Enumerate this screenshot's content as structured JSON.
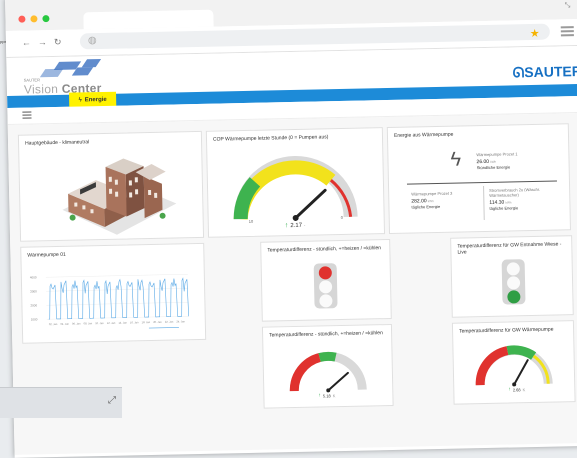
{
  "background": {
    "label": "ppen"
  },
  "app": {
    "logo_small": "SAUTER",
    "logo_title_a": "Vision ",
    "logo_title_b": "Center",
    "brand": "SAUTER",
    "tab_energy": "Energie",
    "tab_energy_icon": "lightning-icon"
  },
  "colors": {
    "accent_blue": "#1d8bd8",
    "tab_yellow": "#fff200",
    "gauge_green": "#3eb34f",
    "gauge_yellow": "#f2e21c",
    "gauge_red": "#e0322e",
    "gauge_grey": "#d9d9d9"
  },
  "cards": {
    "building": {
      "title": "Hauptgebäude - klimaneutral"
    },
    "cop": {
      "title": "COP Wärmepumpe letzte Stunde (0 = Pumpen aus)",
      "value": "2.17",
      "unit": "-",
      "min": "10",
      "max": "0"
    },
    "energy": {
      "title": "Energie aus Wärmepumpe",
      "hour": {
        "label": "Wärmepumpe Prozet 1",
        "value": "26.00",
        "unit": "kWh",
        "caption": "Stündliche Energie"
      },
      "daily_a": {
        "label": "Wärmepumpe Prozet 3",
        "value": "282.00",
        "unit": "kWh",
        "caption": "tägliche Energie"
      },
      "daily_b": {
        "label": "Stromverbrauch 2u (Wäschr. Wärmetauscher)",
        "value": "114.30",
        "unit": "kWh",
        "caption": "tägliche Energie"
      }
    },
    "heatpump01": {
      "title": "Wärmepumpe 01",
      "y_ticks": [
        "4000",
        "3000",
        "2000",
        "1000"
      ],
      "x_ticks": [
        "02. Jan",
        "04. Jan",
        "06. Jan",
        "08. Jan",
        "10. Jan",
        "12. Jan",
        "14. Jan",
        "16. Jan",
        "18. Jan",
        "20. Jan",
        "22. Jan",
        "24. Jan"
      ]
    },
    "temp_diff_hourly": {
      "title": "Temperaturdifferenz - stündlich, +=heizen / =kühlen",
      "state": "red"
    },
    "temp_diff_gw_live": {
      "title": "Temperaturdifferenz für GW Entnahme Wiese - Live",
      "state": "green"
    },
    "temp_diff_hourly_gauge": {
      "title": "Temperaturdifferenz - stündlich, +=heizen / =kühlen",
      "value": "5.18",
      "unit": "K",
      "min": "",
      "max": ""
    },
    "temp_diff_gw_pump": {
      "title": "Temperaturdifferenz für GW Wärmepumpe",
      "value": "2.68",
      "unit": "K"
    }
  }
}
